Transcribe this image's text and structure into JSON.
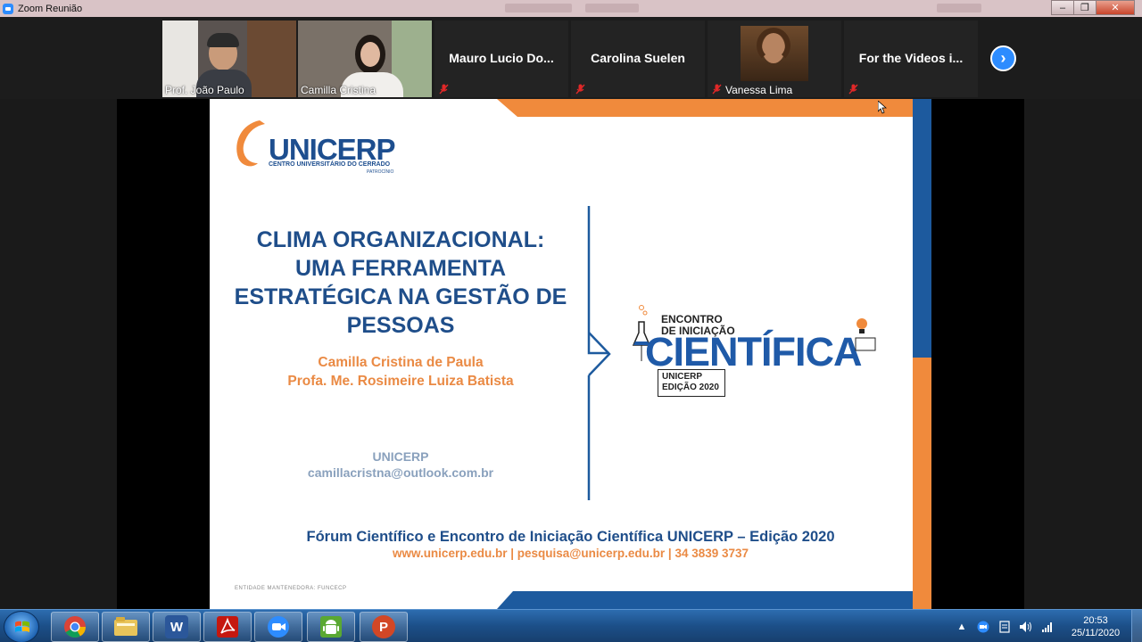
{
  "window": {
    "title": "Zoom Reunião"
  },
  "gallery": {
    "participants": [
      {
        "name": "Prof. João Paulo",
        "video": true,
        "muted": false
      },
      {
        "name": "Camilla Cristina",
        "video": true,
        "muted": false,
        "active": true
      },
      {
        "name": "Mauro Lucio Do...",
        "video": false,
        "muted": true
      },
      {
        "name": "Carolina Suelen",
        "video": false,
        "muted": true
      },
      {
        "name": "Vanessa Lima",
        "video": true,
        "muted": true
      },
      {
        "name": "For the Videos i...",
        "video": false,
        "muted": true
      }
    ],
    "next_icon": "chevron-right-icon"
  },
  "slide": {
    "logo_word": "UNICERP",
    "logo_subtitle": "CENTRO UNIVERSITÁRIO DO CERRADO",
    "logo_city": "PATROCÍNIO",
    "title_lines": [
      "CLIMA ORGANIZACIONAL:",
      "UMA FERRAMENTA",
      "ESTRATÉGICA NA GESTÃO DE",
      "PESSOAS"
    ],
    "authors": [
      "Camilla Cristina de Paula",
      "Profa. Me. Rosimeire Luiza Batista"
    ],
    "institution": "UNICERP",
    "email": "camillacristna@outlook.com.br",
    "event_line1": "ENCONTRO",
    "event_line2": "DE INICIAÇÃO",
    "event_big": "CIENTÍFICA",
    "event_box_line1": "UNICERP",
    "event_box_line2": "EDIÇÃO 2020",
    "footer_title": "Fórum Científico e Encontro de Iniciação Científica UNICERP – Edição 2020",
    "footer_contact": "www.unicerp.edu.br | pesquisa@unicerp.edu.br | 34 3839 3737",
    "mantenedora": "ENTIDADE MANTENEDORA: FUNCECP",
    "colors": {
      "blue": "#1f4e8a",
      "orange": "#ea8a44",
      "gray_blue": "#8aa1bd"
    }
  },
  "taskbar": {
    "apps": [
      {
        "name": "chrome-icon"
      },
      {
        "name": "file-explorer-icon"
      },
      {
        "name": "word-icon",
        "letter": "W"
      },
      {
        "name": "acrobat-icon"
      },
      {
        "name": "zoom-icon"
      },
      {
        "name": "android-icon"
      },
      {
        "name": "powerpoint-icon",
        "letter": "P"
      }
    ],
    "clock_time": "20:53",
    "clock_date": "25/11/2020"
  }
}
